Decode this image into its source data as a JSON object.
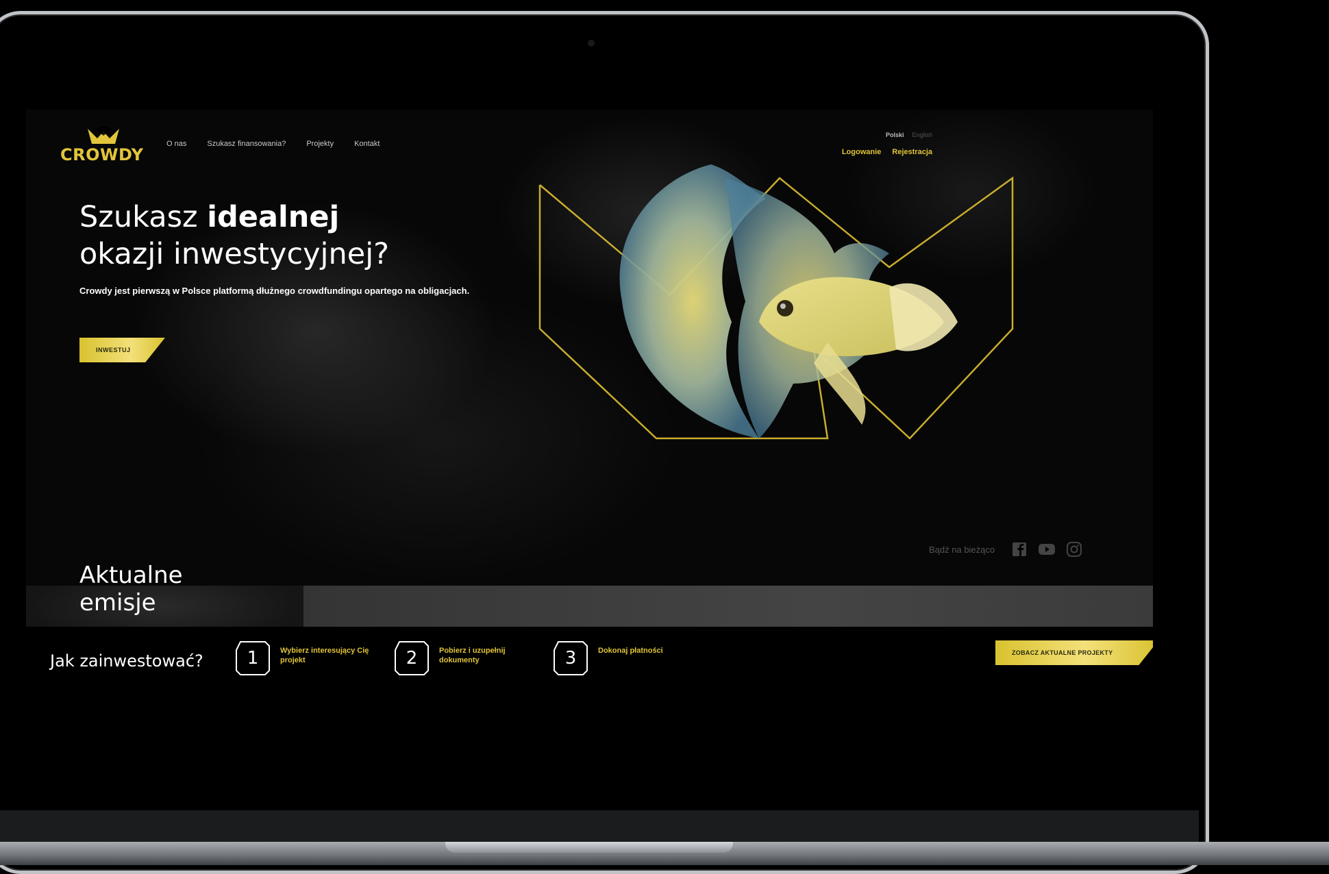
{
  "brand": {
    "name": "CROWDY",
    "accent": "#e0c438"
  },
  "nav": {
    "items": [
      "O nas",
      "Szukasz finansowania?",
      "Projekty",
      "Kontakt"
    ]
  },
  "lang": {
    "active": "Polski",
    "other": "English"
  },
  "auth": {
    "login": "Logowanie",
    "register": "Rejestracja"
  },
  "hero": {
    "title_line1_regular": "Szukasz ",
    "title_line1_bold": "idealnej",
    "title_line2": "okazji inwestycyjnej?",
    "lead": "Crowdy jest pierwszą w Polsce platformą dłużnego crowdfundingu opartego na obligacjach.",
    "cta": "INWESTUJ"
  },
  "social": {
    "label": "Bądź na bieżąco",
    "icons": [
      "facebook-icon",
      "youtube-icon",
      "instagram-icon"
    ]
  },
  "emissions": {
    "title_line1": "Aktualne",
    "title_line2": "emisje"
  },
  "how": {
    "title": "Jak zainwestować?",
    "steps": [
      {
        "number": "1",
        "text": "Wybierz interesujący Cię projekt"
      },
      {
        "number": "2",
        "text": "Pobierz i uzupełnij dokumenty"
      },
      {
        "number": "3",
        "text": "Dokonaj płatności"
      }
    ],
    "cta": "ZOBACZ AKTUALNE PROJEKTY"
  }
}
